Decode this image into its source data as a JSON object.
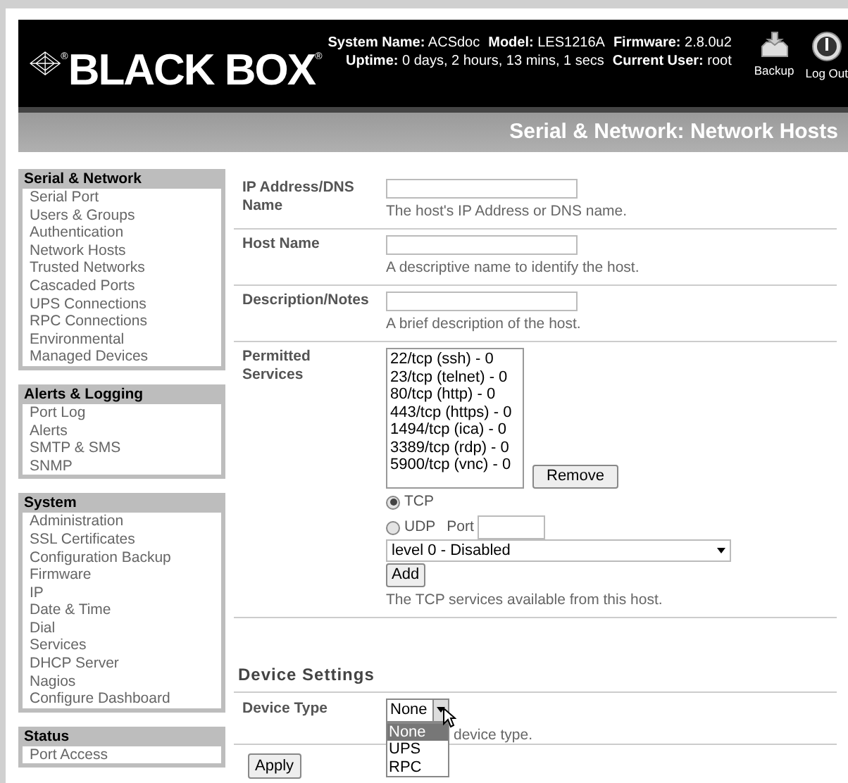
{
  "header": {
    "logo": "BLACK BOX",
    "logo_marks": [
      "®",
      "®"
    ],
    "info": [
      [
        {
          "label": "System Name:",
          "value": "ACSdoc"
        },
        {
          "label": "Model:",
          "value": "LES1216A"
        },
        {
          "label": "Firmware:",
          "value": "2.8.0u2"
        }
      ],
      [
        {
          "label": "Uptime:",
          "value": "0 days, 2 hours, 13 mins, 1 secs"
        },
        {
          "label": "Current User:",
          "value": "root"
        }
      ]
    ],
    "actions": [
      {
        "kind": "backup",
        "label": "Backup"
      },
      {
        "kind": "logout",
        "label": "Log Out"
      }
    ]
  },
  "page_title": "Serial & Network: Network Hosts",
  "sidebar": [
    {
      "title": "Serial & Network",
      "items": [
        "Serial Port",
        "Users & Groups",
        "Authentication",
        "Network Hosts",
        "Trusted Networks",
        "Cascaded Ports",
        "UPS Connections",
        "RPC Connections",
        "Environmental",
        "Managed Devices"
      ]
    },
    {
      "title": "Alerts & Logging",
      "items": [
        "Port Log",
        "Alerts",
        "SMTP & SMS",
        "SNMP"
      ]
    },
    {
      "title": "System",
      "items": [
        "Administration",
        "SSL Certificates",
        "Configuration Backup",
        "Firmware",
        "IP",
        "Date & Time",
        "Dial",
        "Services",
        "DHCP Server",
        "Nagios",
        "Configure Dashboard"
      ]
    },
    {
      "title": "Status",
      "items": [
        "Port Access"
      ]
    }
  ],
  "form": [
    {
      "label": "IP Address/DNS Name",
      "help": "The host's IP Address or DNS name."
    },
    {
      "label": "Host Name",
      "help": "A descriptive name to identify the host."
    },
    {
      "label": "Description/Notes",
      "help": "A brief description of the host."
    }
  ],
  "services": {
    "label": "Permitted Services",
    "list": [
      "22/tcp (ssh) - 0",
      "23/tcp (telnet) - 0",
      "80/tcp (http) - 0",
      "443/tcp (https) - 0",
      "1494/tcp (ica) - 0",
      "3389/tcp (rdp) - 0",
      "5900/tcp (vnc) - 0"
    ],
    "remove_button": "Remove",
    "protocols": [
      {
        "label": "TCP",
        "selected": true
      },
      {
        "label": "UDP",
        "selected": false
      }
    ],
    "port_label": "Port",
    "level_select": "level 0 - Disabled",
    "add_button": "Add",
    "help": "The TCP services available from this host."
  },
  "device_settings": {
    "heading": "Device Settings",
    "label": "Device Type",
    "value": "None",
    "help": "device type.",
    "options": [
      {
        "label": "None",
        "selected": true
      },
      {
        "label": "UPS",
        "selected": false
      },
      {
        "label": "RPC",
        "selected": false
      }
    ]
  },
  "apply_button": "Apply"
}
